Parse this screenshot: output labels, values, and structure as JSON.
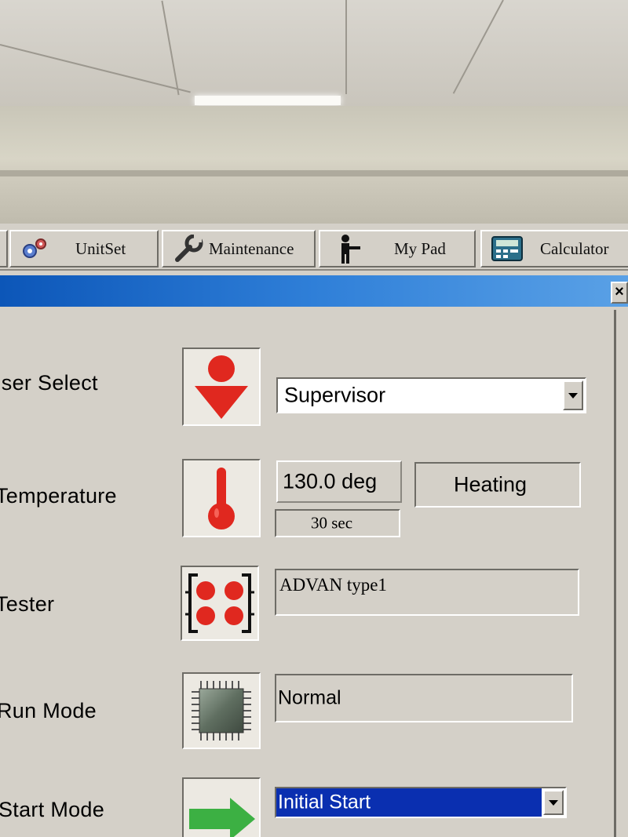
{
  "toolbar": {
    "buttons": [
      {
        "label": "UnitSet",
        "icon": "unitset-gear-icon"
      },
      {
        "label": "Maintenance",
        "icon": "wrench-icon"
      },
      {
        "label": "My Pad",
        "icon": "person-icon"
      },
      {
        "label": "Calculator",
        "icon": "calculator-icon"
      }
    ]
  },
  "window": {
    "close_label": "×"
  },
  "rows": {
    "user_select": {
      "label": "User Select",
      "icon": "user-arrow-icon",
      "value": "Supervisor"
    },
    "temperature": {
      "label": "Temperature",
      "icon": "thermometer-icon",
      "value": "130.0 deg",
      "status": "Heating",
      "duration": "30 sec"
    },
    "tester": {
      "label": "Tester",
      "icon": "tester-sockets-icon",
      "value": "ADVAN type1"
    },
    "run_mode": {
      "label": "Run Mode",
      "icon": "chip-icon",
      "value": "Normal"
    },
    "start_mode": {
      "label": "Start Mode",
      "icon": "green-arrow-icon",
      "value": "Initial Start"
    }
  },
  "colors": {
    "titlebar": "#0c56b8",
    "icon_red": "#e0281f",
    "selection_blue": "#0a2fb0",
    "arrow_green": "#3cb043"
  }
}
